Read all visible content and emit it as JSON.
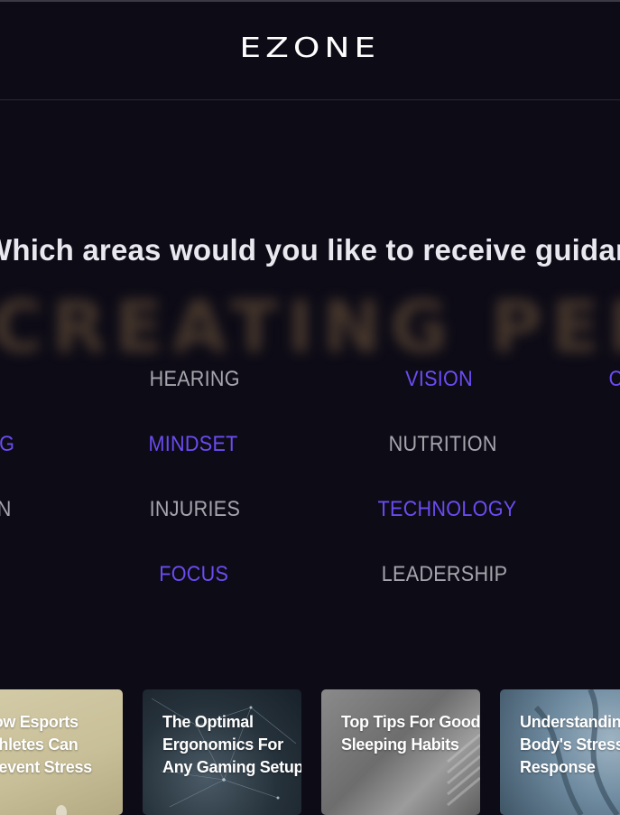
{
  "header": {
    "logo": "EZONE"
  },
  "question": "Which areas would you like to receive guidance in?",
  "background_words": [
    "CREATING PERFORMANCE",
    "",
    ""
  ],
  "areas": [
    {
      "label": "HEARING",
      "selected": false
    },
    {
      "label": "VISION",
      "selected": true
    },
    {
      "label": "COMMUNICATION",
      "selected": true
    },
    {
      "label": "GAMING",
      "selected": true
    },
    {
      "label": "MINDSET",
      "selected": true
    },
    {
      "label": "NUTRITION",
      "selected": false
    },
    {
      "label": "RECREATION",
      "selected": false
    },
    {
      "label": "INJURIES",
      "selected": false
    },
    {
      "label": "TECHNOLOGY",
      "selected": true
    },
    {
      "label": "FOCUS",
      "selected": true
    },
    {
      "label": "LEADERSHIP",
      "selected": false
    }
  ],
  "colors": {
    "background": "#0d0b16",
    "accent": "#6b4cf2",
    "unselected": "#a6a5ae",
    "text": "#e9e8ef"
  },
  "articles": [
    {
      "title": "How Esports Athletes Can Prevent Stress"
    },
    {
      "title": "The Optimal Ergonomics For Any Gaming Setup"
    },
    {
      "title": "Top Tips For Good Sleeping Habits"
    },
    {
      "title": "Understanding The Body's Stress Response"
    }
  ]
}
